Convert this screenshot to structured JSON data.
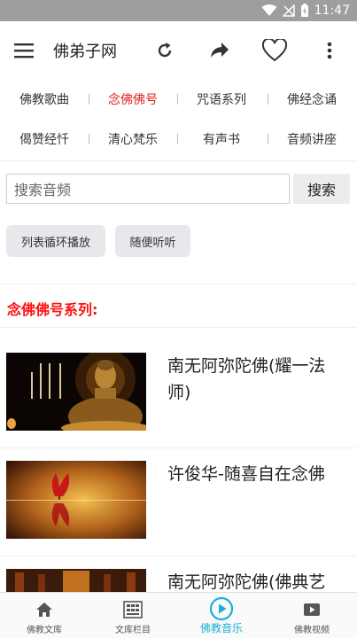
{
  "status_bar": {
    "time": "11:47"
  },
  "app_bar": {
    "title": "佛弟子网",
    "actions": [
      "refresh-icon",
      "share-icon",
      "favorite-icon",
      "more-icon"
    ]
  },
  "categories": {
    "row1": [
      {
        "label": "佛教歌曲",
        "active": false
      },
      {
        "label": "念佛佛号",
        "active": true
      },
      {
        "label": "咒语系列",
        "active": false
      },
      {
        "label": "佛经念诵",
        "active": false
      }
    ],
    "row2": [
      {
        "label": "偈赞经忏",
        "active": false
      },
      {
        "label": "清心梵乐",
        "active": false
      },
      {
        "label": "有声书",
        "active": false
      },
      {
        "label": "音频讲座",
        "active": false
      }
    ]
  },
  "search": {
    "placeholder": "搜索音频",
    "button": "搜索"
  },
  "play_modes": {
    "loop_list": "列表循环播放",
    "shuffle": "随便听听"
  },
  "section": {
    "title": "念佛佛号系列:"
  },
  "items": [
    {
      "title": "南无阿弥陀佛(耀一法师)"
    },
    {
      "title": "许俊华-随喜自在念佛"
    },
    {
      "title": "南无阿弥陀佛(佛典艺"
    }
  ],
  "bottom_nav": [
    {
      "label": "佛教文库",
      "icon": "home-icon",
      "active": false
    },
    {
      "label": "文库栏目",
      "icon": "grid-icon",
      "active": false
    },
    {
      "label": "佛教音乐",
      "icon": "play-circle-icon",
      "active": true
    },
    {
      "label": "佛教视频",
      "icon": "video-icon",
      "active": false
    }
  ],
  "colors": {
    "accent_red": "#e02020",
    "section_red": "#ff1111",
    "nav_active": "#1ab0d8",
    "status_bar": "#9e9e9e"
  }
}
